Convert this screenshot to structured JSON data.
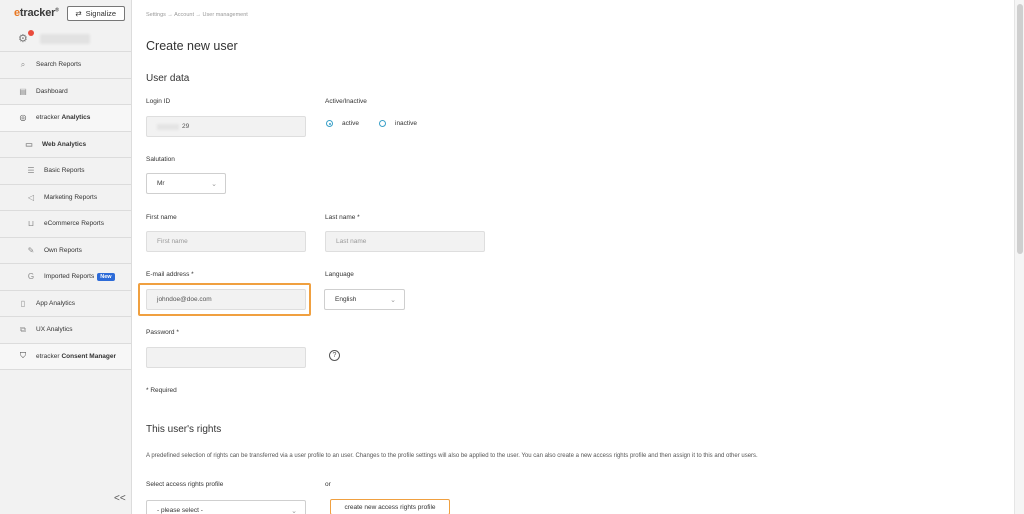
{
  "brand": {
    "logo_e": "e",
    "logo_rest": "tracker",
    "logo_reg": "®",
    "signalize_label": "Signalize"
  },
  "user": {
    "notification_color": "#e94b3c"
  },
  "nav": {
    "search_reports": "Search Reports",
    "dashboard": "Dashboard",
    "analytics_prefix": "etracker",
    "analytics_bold": "Analytics",
    "web_analytics": "Web Analytics",
    "basic_reports": "Basic Reports",
    "marketing_reports": "Marketing Reports",
    "ecommerce_reports": "eCommerce Reports",
    "own_reports": "Own Reports",
    "imported_reports": "Imported Reports",
    "new_badge": "New",
    "app_analytics": "App Analytics",
    "ux_analytics": "UX Analytics",
    "consent_prefix": "etracker",
    "consent_bold": "Consent Manager",
    "collapse": "<<"
  },
  "breadcrumb": "Settings → Account → User management",
  "page_title": "Create new user",
  "user_data": {
    "section_title": "User data",
    "login_id_label": "Login ID",
    "login_id_value": "29",
    "active_label": "Active/Inactive",
    "active_option": "active",
    "inactive_option": "inactive",
    "salutation_label": "Salutation",
    "salutation_value": "Mr",
    "first_name_label": "First name",
    "first_name_placeholder": "First name",
    "last_name_label": "Last name *",
    "last_name_placeholder": "Last name",
    "email_label": "E-mail address *",
    "email_value": "johndoe@doe.com",
    "language_label": "Language",
    "language_value": "English",
    "password_label": "Password *",
    "help_glyph": "?",
    "required_note": "* Required"
  },
  "rights": {
    "section_title": "This user's rights",
    "description": "A predefined selection of rights can be transferred via a user profile to an user. Changes to the profile settings will also be applied to the user. You can also create a new access rights profile and then assign it to this and other users.",
    "select_profile_label": "Select access rights profile",
    "or_label": "or",
    "select_placeholder": "- please select -",
    "create_profile_button": "create new access rights profile"
  },
  "colors": {
    "accent_orange": "#f0a040",
    "radio_blue": "#3aa0c8",
    "new_badge_blue": "#2d6bd8"
  }
}
